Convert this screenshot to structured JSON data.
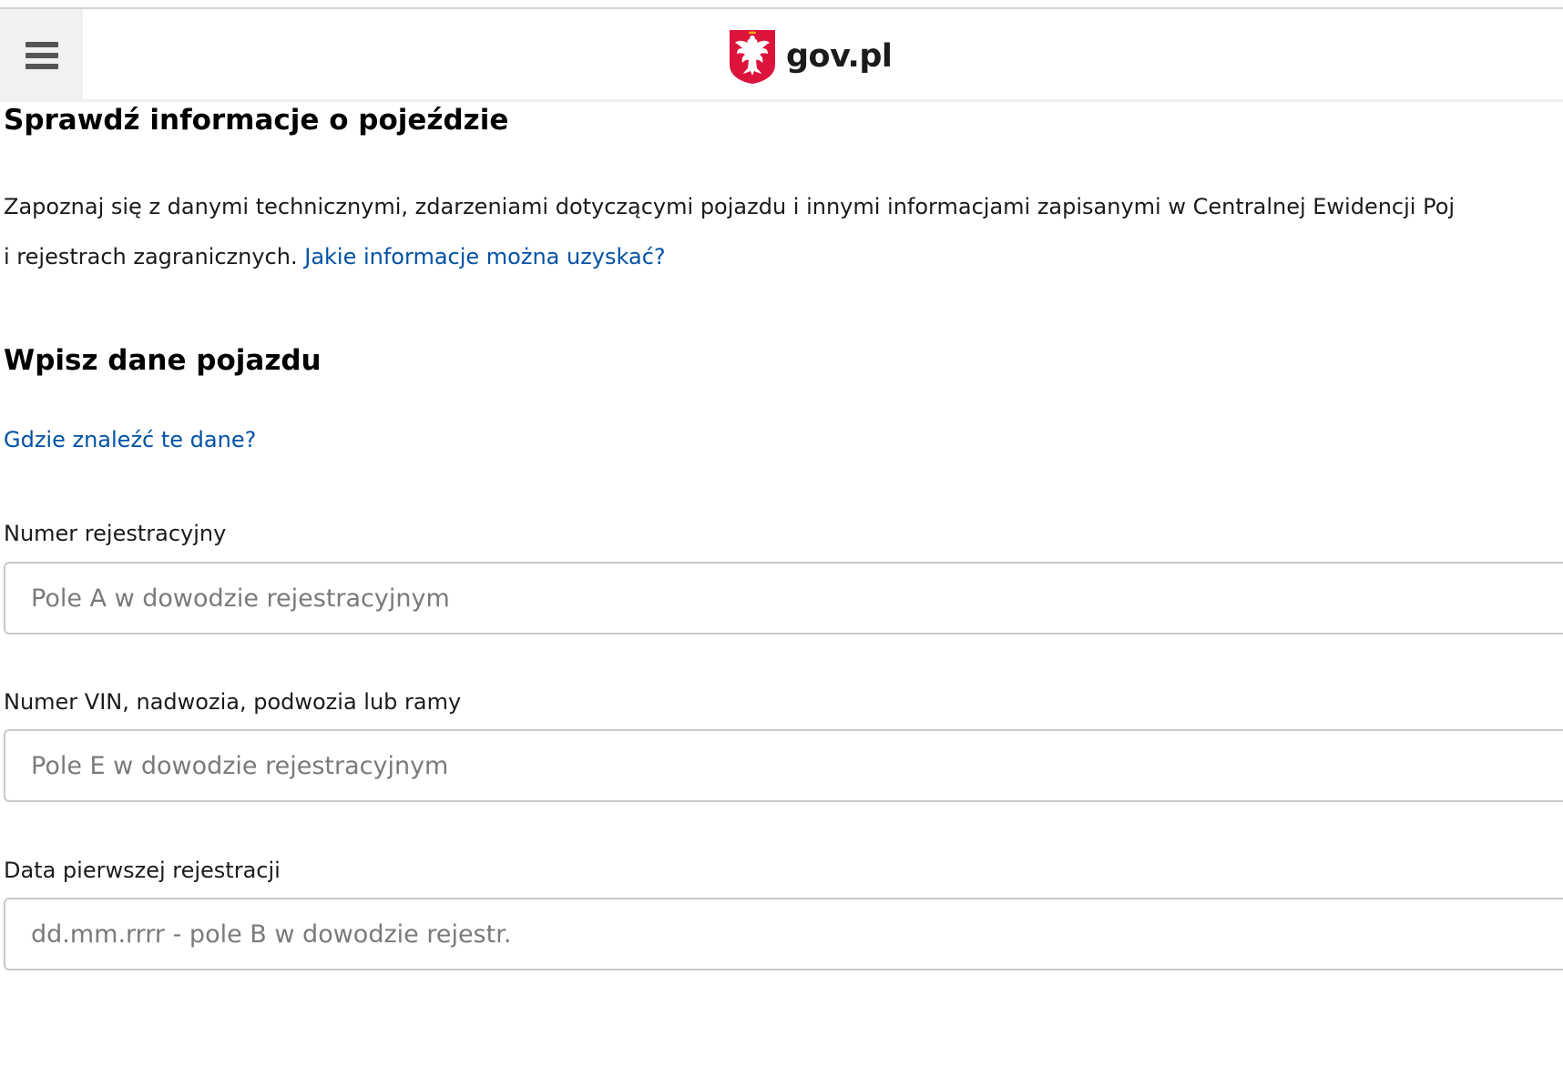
{
  "header": {
    "menu_icon": "hamburger-menu-icon",
    "logo_icon": "polish-eagle-emblem-icon",
    "logo_text": "gov.pl",
    "accent_color": "#dc143c"
  },
  "page": {
    "title": "Sprawdź informacje o pojeździe",
    "intro_line1": "Zapoznaj się z danymi technicznymi, zdarzeniami dotyczącymi pojazdu i innymi informacjami zapisanymi w Centralnej Ewidencji Poj",
    "intro_line2": "i rejestrach zagranicznych.",
    "intro_link": "Jakie informacje można uzyskać?",
    "link_color": "#0052a5"
  },
  "form": {
    "section_title": "Wpisz dane pojazdu",
    "help_link": "Gdzie znaleźć te dane?",
    "fields": [
      {
        "label": "Numer rejestracyjny",
        "placeholder": "Pole A w dowodzie rejestracyjnym",
        "value": ""
      },
      {
        "label": "Numer VIN, nadwozia, podwozia lub ramy",
        "placeholder": "Pole E w dowodzie rejestracyjnym",
        "value": ""
      },
      {
        "label": "Data pierwszej rejestracji",
        "placeholder": "dd.mm.rrrr - pole B w dowodzie rejestr.",
        "value": ""
      }
    ]
  }
}
